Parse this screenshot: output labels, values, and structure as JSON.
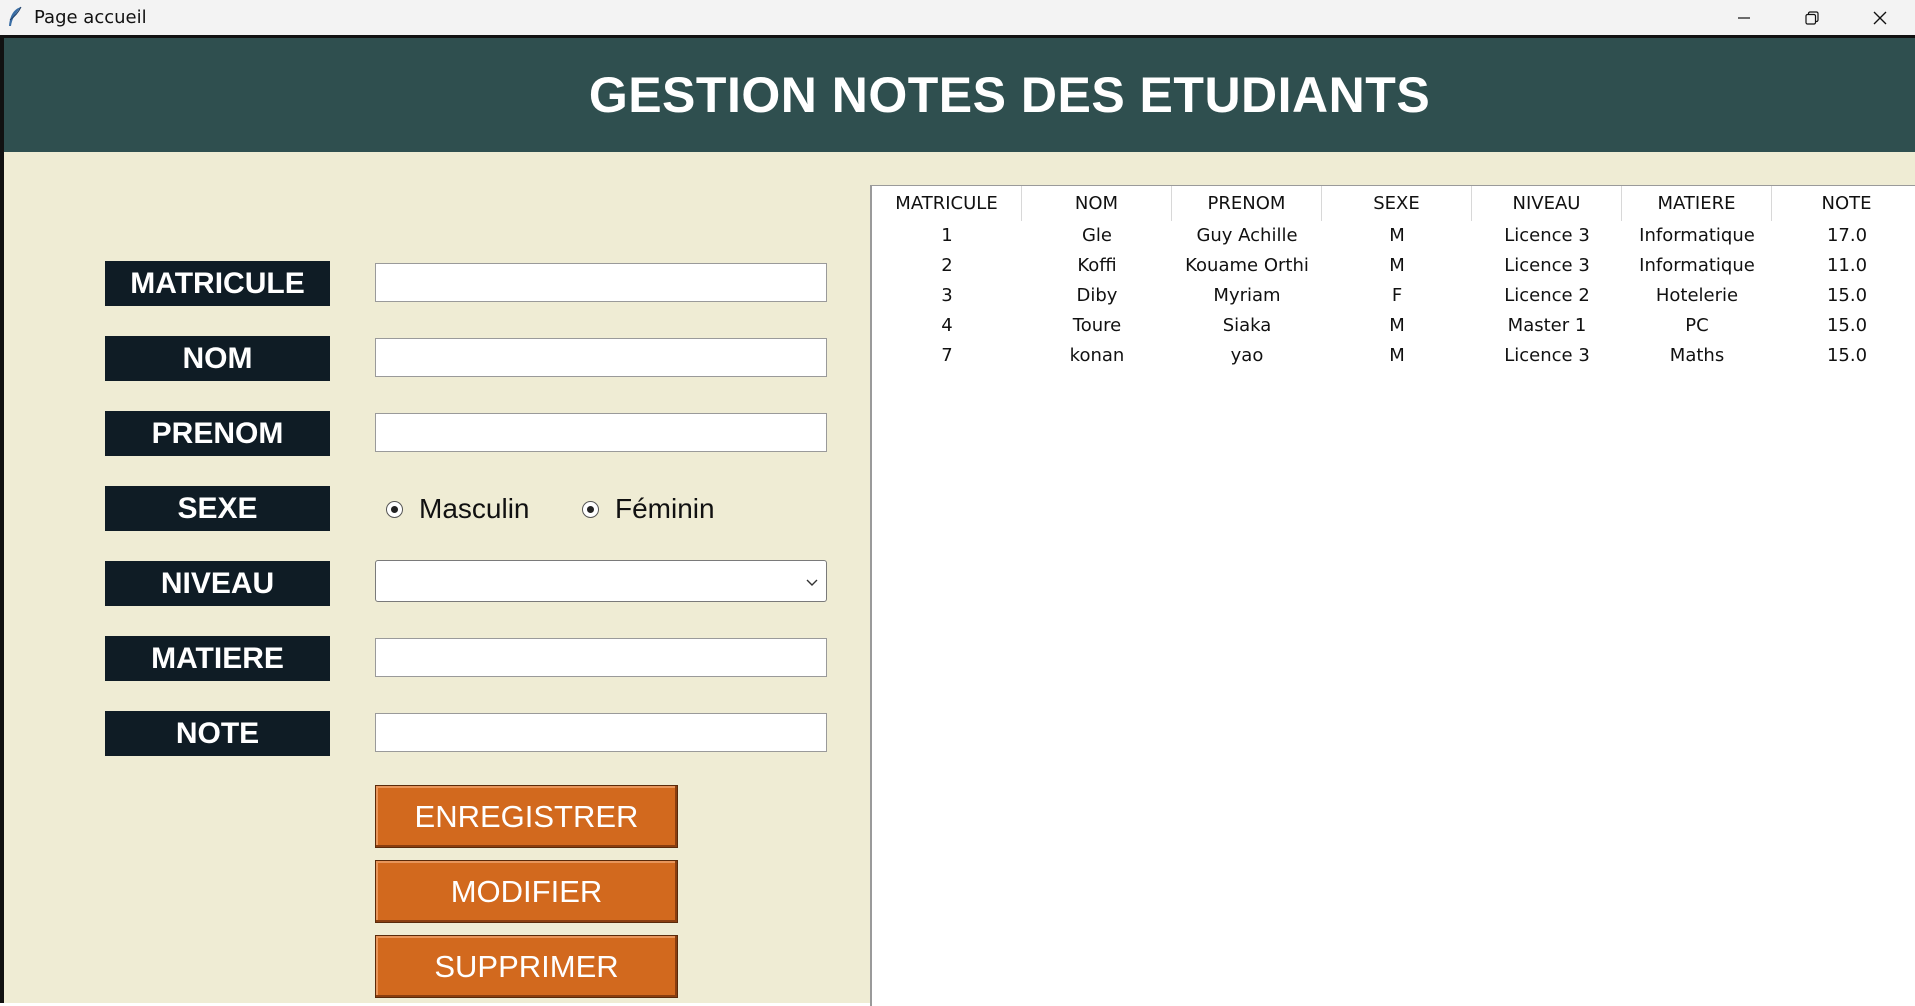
{
  "window": {
    "title": "Page accueil"
  },
  "header": {
    "title": "GESTION NOTES DES ETUDIANTS"
  },
  "form": {
    "matricule_label": "MATRICULE",
    "nom_label": "NOM",
    "prenom_label": "PRENOM",
    "sexe_label": "SEXE",
    "niveau_label": "NIVEAU",
    "matiere_label": "MATIERE",
    "note_label": "NOTE",
    "matricule_value": "",
    "nom_value": "",
    "prenom_value": "",
    "niveau_value": "",
    "matiere_value": "",
    "note_value": "",
    "sexe_options": [
      "Masculin",
      "Féminin"
    ]
  },
  "buttons": {
    "save": "ENREGISTRER",
    "modify": "MODIFIER",
    "delete": "SUPPRIMER"
  },
  "table": {
    "columns": [
      "MATRICULE",
      "NOM",
      "PRENOM",
      "SEXE",
      "NIVEAU",
      "MATIERE",
      "NOTE"
    ],
    "rows": [
      [
        "1",
        "Gle",
        "Guy Achille",
        "M",
        "Licence 3",
        "Informatique",
        "17.0"
      ],
      [
        "2",
        "Koffi",
        "Kouame Orthi",
        "M",
        "Licence 3",
        "Informatique",
        "11.0"
      ],
      [
        "3",
        "Diby",
        "Myriam",
        "F",
        "Licence 2",
        "Hotelerie",
        "15.0"
      ],
      [
        "4",
        "Toure",
        "Siaka",
        "M",
        "Master 1",
        "PC",
        "15.0"
      ],
      [
        "7",
        "konan",
        "yao",
        "M",
        "Licence 3",
        "Maths",
        "15.0"
      ]
    ]
  },
  "colors": {
    "header_bg": "#2f4f4f",
    "form_bg": "#efecd4",
    "label_bg": "#0f1c25",
    "button_bg": "#d2691e"
  }
}
